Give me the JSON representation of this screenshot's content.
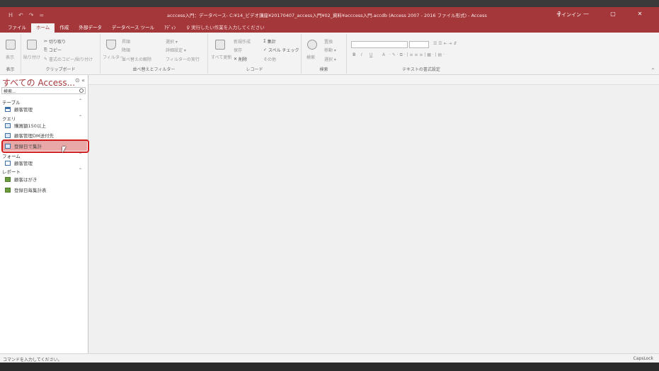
{
  "titlebar": {
    "title": "acccess入門：データベース- C:¥14_ビデオ講座¥20170407_access入門¥02_資料¥acccess入門.accdb (Access 2007 - 2016 ファイル形式) - Access",
    "signin": "サインイン",
    "help": "?",
    "qat": [
      "H",
      "↶",
      "↷",
      "="
    ],
    "accent": "#a4373a"
  },
  "tabs": {
    "items": [
      "ファイル",
      "ホーム",
      "作成",
      "外部データ",
      "データベース ツール",
      "ｱﾃﾞｨﾝ"
    ],
    "active": "ホーム",
    "tell_me": "♀ 実行したい作業を入力してください"
  },
  "ribbon": {
    "view": {
      "label": "表示",
      "group": "表示"
    },
    "clipboard": {
      "paste": "貼り付け",
      "cut": "切り取り",
      "copy": "コピー",
      "format_painter": "書式のコピー/貼り付け",
      "group": "クリップボード"
    },
    "sort_filter": {
      "filter": "フィルター",
      "asc": "昇順",
      "desc": "降順",
      "clear_sort": "並べ替えの解除",
      "selection": "選択 ▾",
      "advanced": "詳細設定 ▾",
      "toggle": "フィルターの実行",
      "group": "並べ替えとフィルター"
    },
    "records": {
      "refresh": "すべて更新",
      "new": "新規作成",
      "save": "保存",
      "delete": "削除",
      "totals": "集計",
      "spelling": "スペル チェック",
      "more": "その他",
      "group": "レコード"
    },
    "find": {
      "find": "検索",
      "replace": "置換",
      "goto": "移動 ▾",
      "select": "選択 ▾",
      "group": "検索"
    },
    "text_format": {
      "bold": "B",
      "italic": "I",
      "underline": "U",
      "font_color": "A",
      "group": "テキストの書式設定"
    }
  },
  "nav": {
    "title": "すべての Access...",
    "search_placeholder": "検索...",
    "categories": [
      {
        "label": "テーブル",
        "items": [
          "顧客管理"
        ]
      },
      {
        "label": "クエリ",
        "items": [
          "購買額150以上",
          "顧客管理DM送付先",
          "登録日で集計"
        ]
      },
      {
        "label": "フォーム",
        "items": [
          "顧客管理"
        ]
      },
      {
        "label": "レポート",
        "items": [
          "顧客はがき",
          "登録日毎集計表"
        ]
      }
    ],
    "selected_item": "登録日で集計"
  },
  "status": {
    "left": "コマンドを入力してください。",
    "right": "CapsLock"
  }
}
